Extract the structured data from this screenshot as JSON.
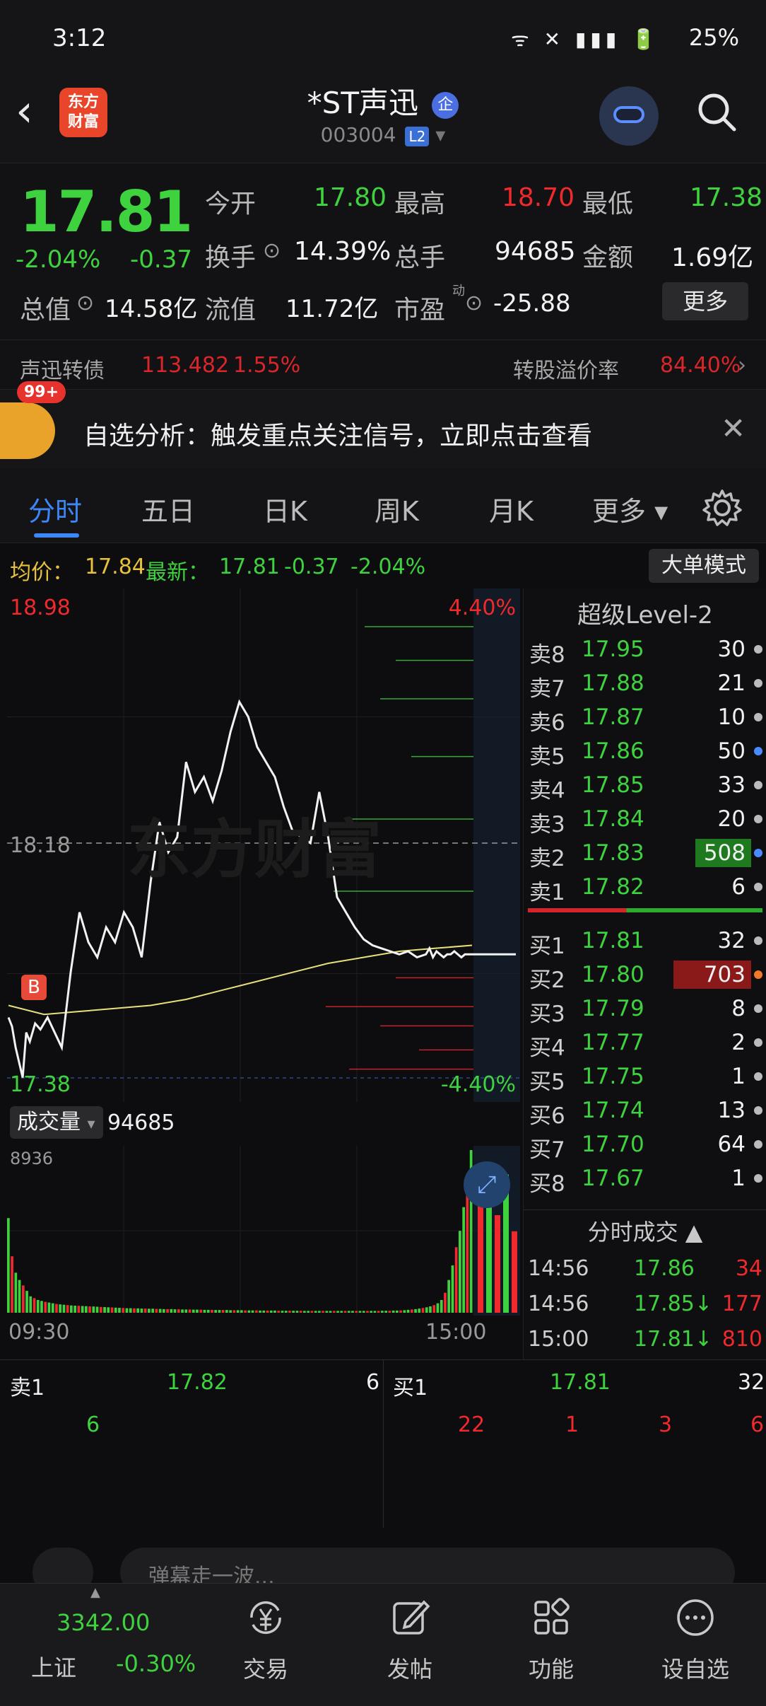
{
  "status_bar": {
    "time": "3:12",
    "battery": "25%",
    "icons": "ᯤ ✕ ▮▮▮ 🔋"
  },
  "header": {
    "logo_text": "东方\n财富",
    "stock_name": "*ST声迅",
    "stock_badge": "企",
    "stock_code": "003004",
    "level_badge": "L2"
  },
  "quote": {
    "price": "17.81",
    "change_pct": "-2.04%",
    "change_amt": "-0.37",
    "open_label": "今开",
    "open": "17.80",
    "high_label": "最高",
    "high": "18.70",
    "low_label": "最低",
    "low": "17.38",
    "turnover_label": "换手",
    "turnover": "14.39%",
    "volume_label": "总手",
    "volume": "94685",
    "amount_label": "金额",
    "amount": "1.69亿",
    "mcap_label": "总值",
    "mcap": "14.58亿",
    "float_label": "流值",
    "float_cap": "11.72亿",
    "pe_label": "市盈",
    "pe_sup": "动",
    "pe": "-25.88",
    "more_label": "更多"
  },
  "bond": {
    "name": "声迅转债",
    "price": "113.482",
    "pct": "1.55%",
    "premium_label": "转股溢价率",
    "premium": "84.40%",
    "arrow": "›"
  },
  "notice": {
    "badge": "99+",
    "text": "自选分析：触发重点关注信号，立即点击查看",
    "close": "✕"
  },
  "tabs": [
    {
      "label": "分时"
    },
    {
      "label": "五日"
    },
    {
      "label": "日K"
    },
    {
      "label": "周K"
    },
    {
      "label": "月K"
    },
    {
      "label": "更多 ▾"
    }
  ],
  "avg_row": {
    "avg_label": "均价：",
    "avg": "17.84",
    "latest_label": "最新：",
    "latest": "17.81",
    "chg": "-0.37",
    "chg_pct": "-2.04%",
    "mode_button": "大单模式"
  },
  "chart_data": {
    "type": "line",
    "title": "",
    "ylim": [
      17.38,
      18.98
    ],
    "prev_close": 18.18,
    "ytick_top": "18.98",
    "ytick_mid": "18.18",
    "ytick_bottom": "17.38",
    "pct_top": "4.40%",
    "pct_bottom": "-4.40%",
    "series": [
      {
        "name": "",
        "x": [
          0,
          2,
          4,
          6,
          8,
          10,
          12,
          15,
          18,
          22,
          26,
          30,
          35,
          40,
          45,
          50,
          55,
          60,
          65,
          70,
          75,
          80,
          85,
          90,
          95,
          100,
          105,
          110,
          115,
          120,
          125,
          130,
          135,
          140,
          145,
          150,
          155,
          160,
          165,
          170,
          175,
          180,
          185,
          190,
          195,
          200,
          205,
          210,
          215,
          220,
          225,
          230,
          235,
          237,
          239,
          241,
          243,
          245,
          247,
          249,
          251,
          253,
          255,
          257,
          259,
          261
        ],
        "values": [
          17.6,
          17.57,
          17.5,
          17.45,
          17.4,
          17.55,
          17.52,
          17.58,
          17.56,
          17.6,
          17.55,
          17.5,
          17.75,
          17.95,
          17.85,
          17.8,
          17.9,
          17.85,
          17.95,
          17.9,
          17.8,
          18.05,
          18.25,
          18.15,
          18.2,
          18.45,
          18.35,
          18.4,
          18.32,
          18.42,
          18.55,
          18.65,
          18.6,
          18.5,
          18.45,
          18.4,
          18.3,
          18.22,
          18.2,
          18.18,
          18.35,
          18.2,
          18.0,
          17.95,
          17.9,
          17.86,
          17.84,
          17.83,
          17.82,
          17.81,
          17.82,
          17.8,
          17.81,
          17.83,
          17.8,
          17.82,
          17.81,
          17.8,
          17.81,
          17.81,
          17.82,
          17.81,
          17.8,
          17.81,
          17.81,
          17.81
        ]
      },
      {
        "name": "",
        "x": [
          0,
          20,
          40,
          60,
          80,
          100,
          120,
          140,
          160,
          180,
          200,
          220,
          240,
          261
        ],
        "values": [
          17.64,
          17.61,
          17.62,
          17.63,
          17.64,
          17.66,
          17.69,
          17.72,
          17.75,
          17.78,
          17.8,
          17.82,
          17.83,
          17.84
        ]
      }
    ],
    "volume_label": "成交量",
    "volume_total": "94685",
    "volume_max": "8936",
    "x_start": "09:30",
    "x_end": "15:00",
    "volume_bars": [
      5200,
      3100,
      2200,
      1800,
      1500,
      1200,
      900,
      800,
      700,
      650,
      600,
      560,
      520,
      480,
      460,
      440,
      420,
      400,
      390,
      380,
      370,
      360,
      350,
      340,
      330,
      320,
      310,
      300,
      290,
      280,
      270,
      260,
      250,
      250,
      240,
      240,
      230,
      230,
      220,
      220,
      210,
      210,
      200,
      200,
      200,
      190,
      190,
      180,
      180,
      180,
      170,
      170,
      170,
      160,
      160,
      160,
      150,
      150,
      150,
      150,
      140,
      140,
      140,
      140,
      130,
      130,
      130,
      130,
      120,
      120,
      120,
      120,
      120,
      110,
      110,
      110,
      110,
      110,
      110,
      110,
      100,
      100,
      100,
      100,
      100,
      100,
      100,
      100,
      100,
      100,
      100,
      100,
      100,
      100,
      100,
      100,
      100,
      100,
      100,
      100,
      100,
      110,
      110,
      110,
      120,
      120,
      130,
      140,
      160,
      180,
      200,
      230,
      260,
      300,
      350,
      420,
      520,
      700,
      1100,
      1800,
      2600,
      3600,
      4500,
      5800,
      6800,
      8936
    ]
  },
  "level2": {
    "title": "超级Level-2",
    "asks": [
      {
        "label": "卖8",
        "price": "17.95",
        "vol": "30"
      },
      {
        "label": "卖7",
        "price": "17.88",
        "vol": "21"
      },
      {
        "label": "卖6",
        "price": "17.87",
        "vol": "10"
      },
      {
        "label": "卖5",
        "price": "17.86",
        "vol": "50"
      },
      {
        "label": "卖4",
        "price": "17.85",
        "vol": "33"
      },
      {
        "label": "卖3",
        "price": "17.84",
        "vol": "20"
      },
      {
        "label": "卖2",
        "price": "17.83",
        "vol": "508"
      },
      {
        "label": "卖1",
        "price": "17.82",
        "vol": "6"
      }
    ],
    "bids": [
      {
        "label": "买1",
        "price": "17.81",
        "vol": "32"
      },
      {
        "label": "买2",
        "price": "17.80",
        "vol": "703"
      },
      {
        "label": "买3",
        "price": "17.79",
        "vol": "8"
      },
      {
        "label": "买4",
        "price": "17.77",
        "vol": "2"
      },
      {
        "label": "买5",
        "price": "17.75",
        "vol": "1"
      },
      {
        "label": "买6",
        "price": "17.74",
        "vol": "13"
      },
      {
        "label": "买7",
        "price": "17.70",
        "vol": "64"
      },
      {
        "label": "买8",
        "price": "17.67",
        "vol": "1"
      }
    ],
    "ask_bar_level": 0.72,
    "bid_bar_level": 1.0,
    "ticks_title": "分时成交 ▲",
    "ticks": [
      {
        "time": "14:56",
        "price": "17.86",
        "vol": "34"
      },
      {
        "time": "14:56",
        "price": "17.85↓",
        "vol": "177"
      },
      {
        "time": "15:00",
        "price": "17.81↓",
        "vol": "810"
      }
    ]
  },
  "bottom_book": {
    "sell_label": "卖1",
    "sell_price": "17.82",
    "sell_vol": "6",
    "buy_label": "买1",
    "buy_price": "17.81",
    "buy_vol": "32",
    "sell_detail": [
      "6"
    ],
    "buy_detail": [
      "22",
      "1",
      "3",
      "6"
    ]
  },
  "comment_bar": {
    "placeholder": "弹幕走一波..."
  },
  "nav": {
    "index_value": "3342.00",
    "index_name": "上证",
    "index_change": "-0.30%",
    "items": [
      {
        "label": "交易"
      },
      {
        "label": "发帖"
      },
      {
        "label": "功能"
      },
      {
        "label": "设自选"
      }
    ]
  },
  "colors": {
    "up": "#f0292d",
    "down": "#3fd23f",
    "accent": "#3d86f6",
    "avg_line": "#e8e07a"
  },
  "icons": {
    "back": "back-icon",
    "search": "search-icon",
    "settings": "gear-icon",
    "expand": "expand-icon",
    "trade": "yen-cycle-icon",
    "post": "edit-icon",
    "function": "grid-icon",
    "watchlist": "dots-circle-icon"
  }
}
